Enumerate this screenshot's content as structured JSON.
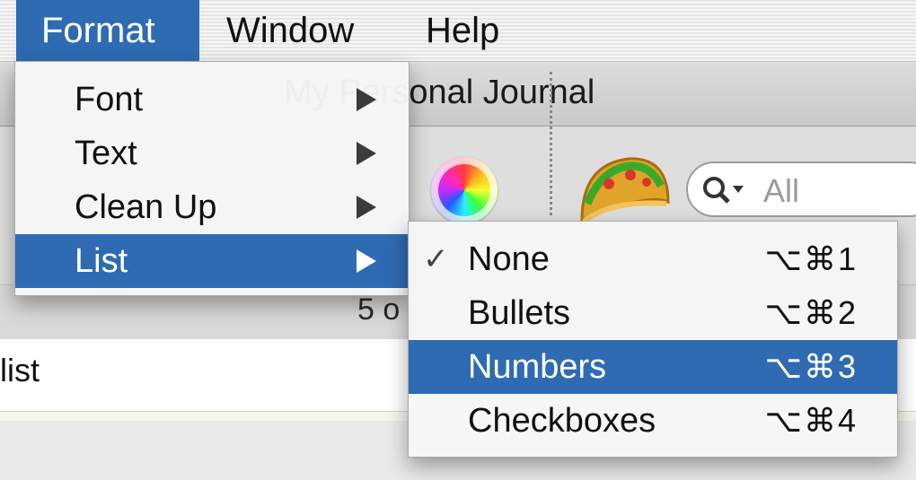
{
  "menubar": {
    "items": [
      {
        "label": "Format",
        "active": true
      },
      {
        "label": "Window",
        "active": false
      },
      {
        "label": "Help",
        "active": false
      }
    ]
  },
  "window": {
    "title": "My Personal Journal",
    "status": "5 o",
    "list_row_text": "list"
  },
  "toolbar": {
    "search_placeholder": "All",
    "icons": [
      "color-wheel-icon",
      "taco-icon",
      "search-icon"
    ]
  },
  "format_menu": {
    "items": [
      {
        "label": "Font",
        "has_submenu": true,
        "highlighted": false
      },
      {
        "label": "Text",
        "has_submenu": true,
        "highlighted": false
      },
      {
        "label": "Clean Up",
        "has_submenu": true,
        "highlighted": false
      },
      {
        "label": "List",
        "has_submenu": true,
        "highlighted": true
      }
    ]
  },
  "list_submenu": {
    "items": [
      {
        "label": "None",
        "shortcut": "⌥⌘1",
        "checked": true,
        "highlighted": false
      },
      {
        "label": "Bullets",
        "shortcut": "⌥⌘2",
        "checked": false,
        "highlighted": false
      },
      {
        "label": "Numbers",
        "shortcut": "⌥⌘3",
        "checked": false,
        "highlighted": true
      },
      {
        "label": "Checkboxes",
        "shortcut": "⌥⌘4",
        "checked": false,
        "highlighted": false
      }
    ],
    "check_mark": "✓"
  },
  "colors": {
    "highlight": "#2f6bb2",
    "menu_background": "#f6f6f6"
  }
}
